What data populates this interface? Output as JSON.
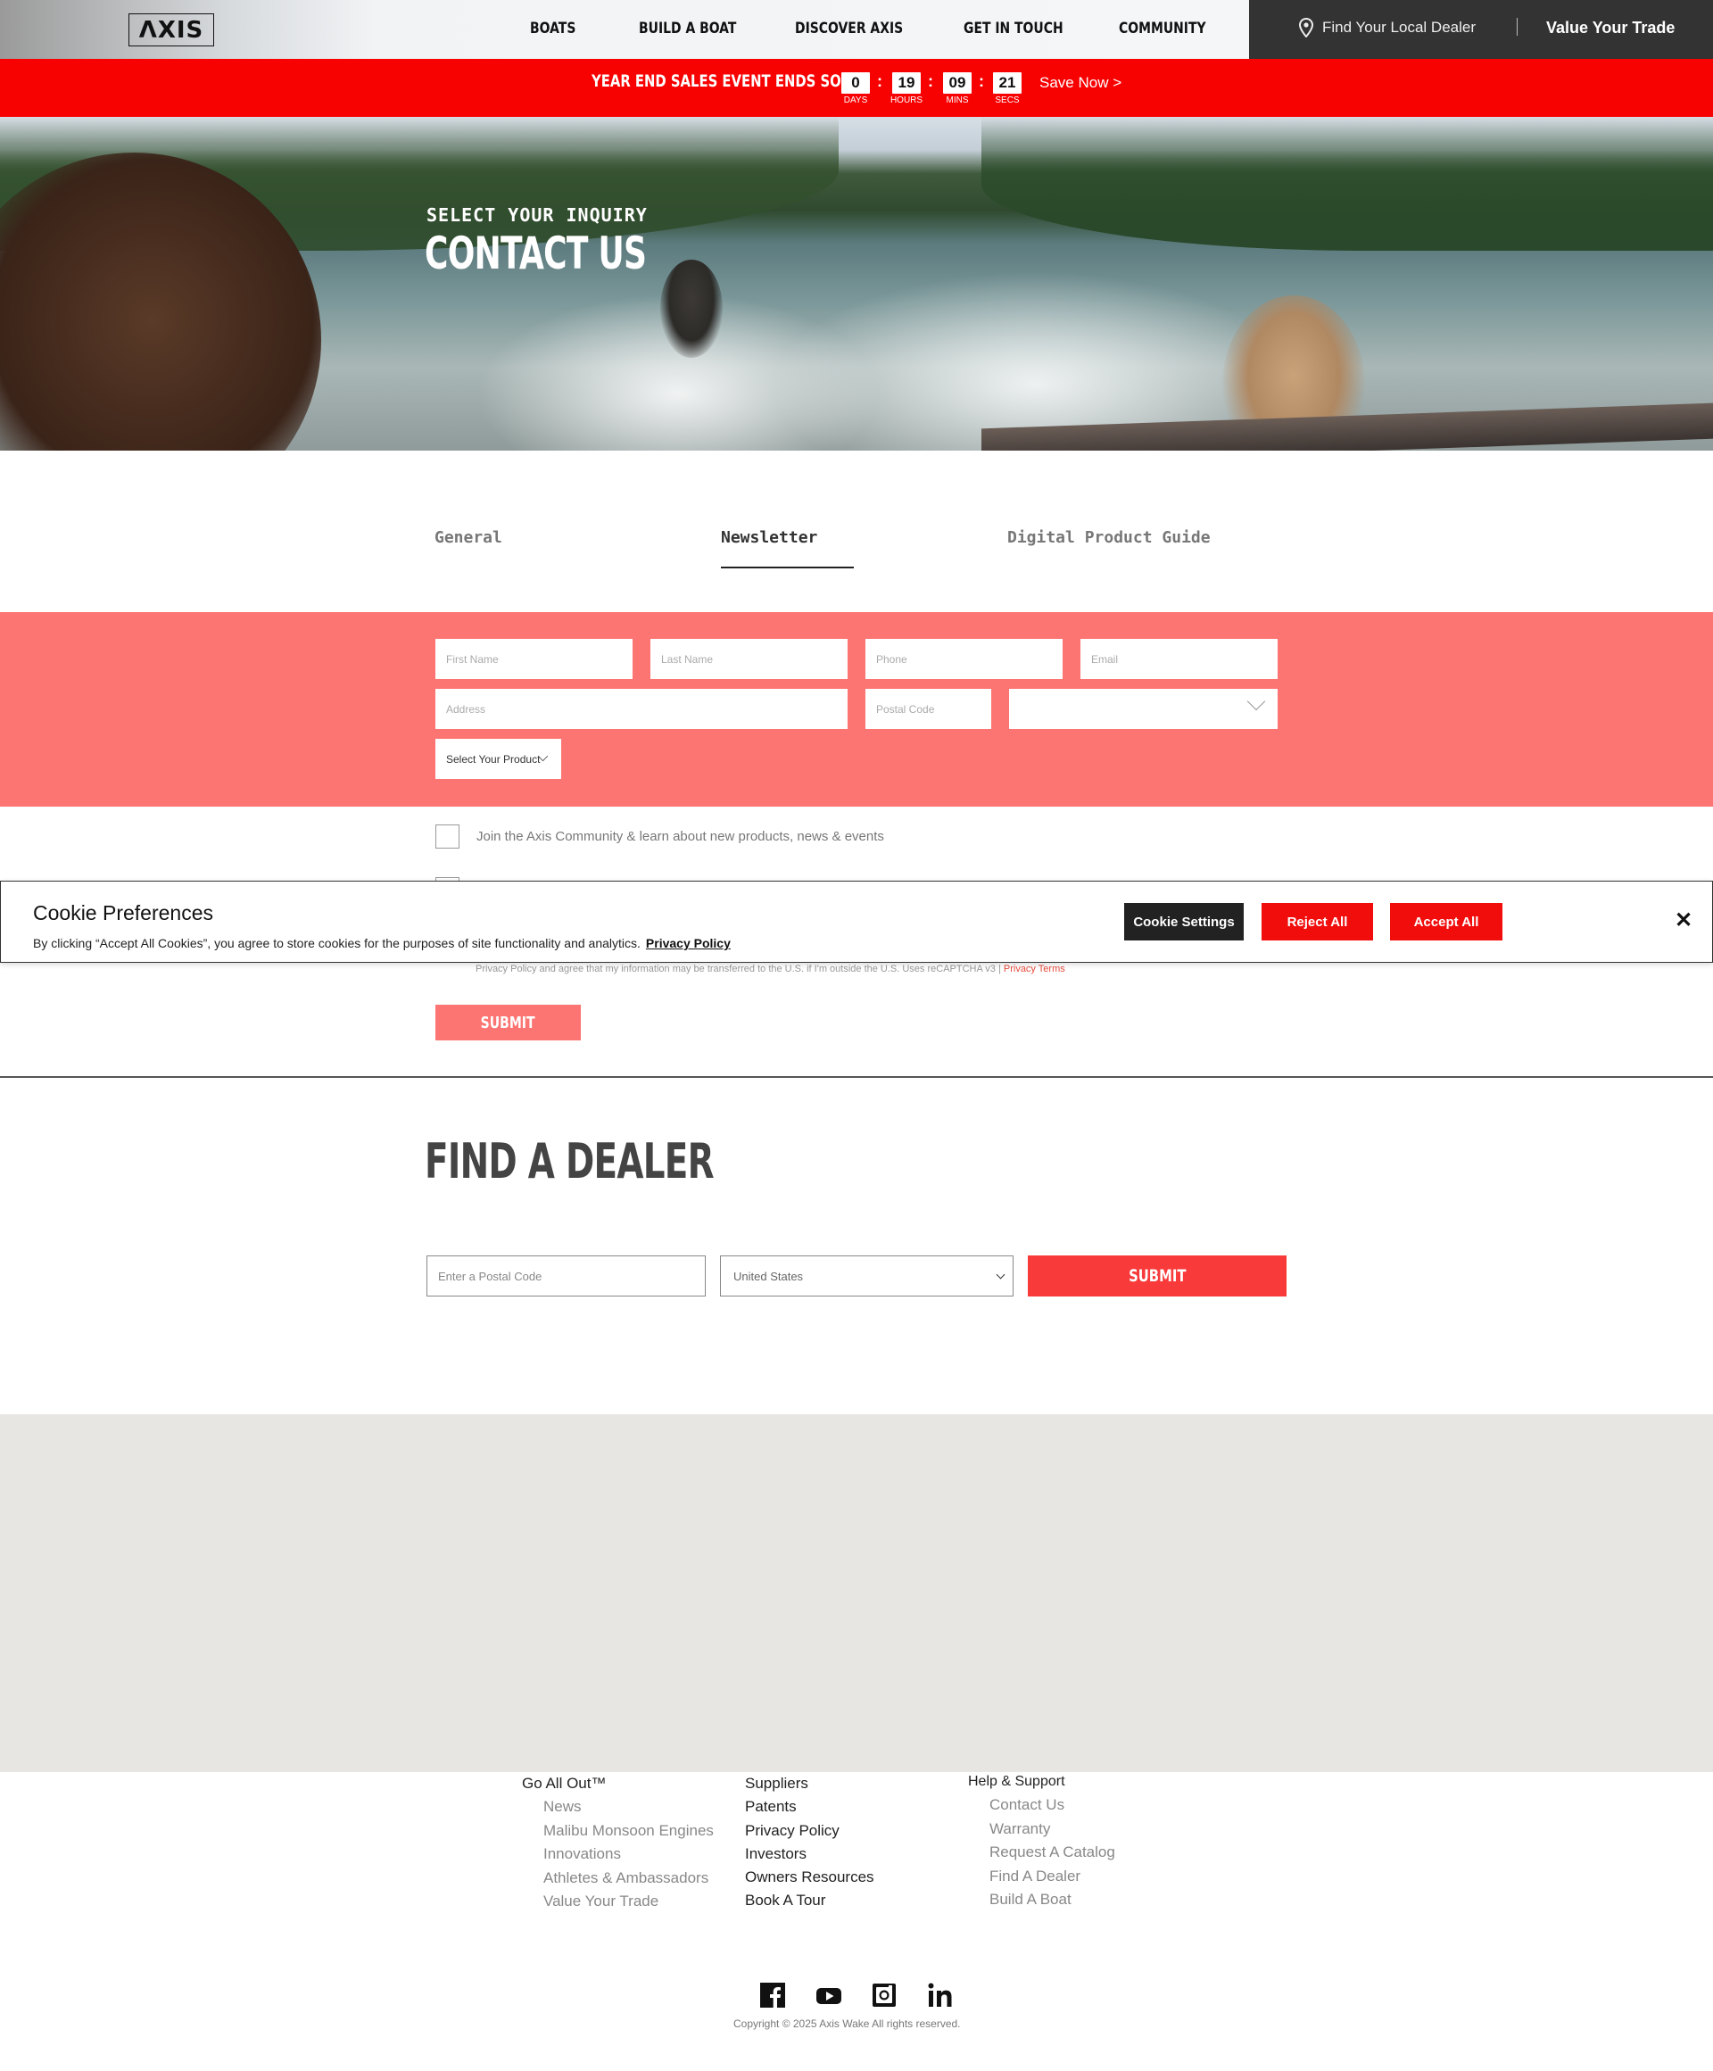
{
  "header": {
    "logo_text": "ΛXIS",
    "nav": [
      "BOATS",
      "BUILD A BOAT",
      "DISCOVER AXIS",
      "GET IN TOUCH",
      "COMMUNITY"
    ],
    "dealer_link": "Find Your Local Dealer",
    "trade_link": "Value Your Trade"
  },
  "promo": {
    "text": "YEAR END SALES EVENT ENDS SOON",
    "countdown": [
      {
        "value": "0",
        "label": "DAYS"
      },
      {
        "value": "19",
        "label": "HOURS"
      },
      {
        "value": "09",
        "label": "MINS"
      },
      {
        "value": "21",
        "label": "SECS"
      }
    ],
    "cta": "Save Now >"
  },
  "hero": {
    "subtitle": "SELECT YOUR INQUIRY",
    "title": "CONTACT US"
  },
  "tabs": [
    {
      "label": "General",
      "active": false
    },
    {
      "label": "Newsletter",
      "active": true
    },
    {
      "label": "Digital Product Guide",
      "active": false
    }
  ],
  "form": {
    "first_name": "First Name",
    "last_name": "Last Name",
    "phone": "Phone",
    "email": "Email",
    "address": "Address",
    "postal_code": "Postal Code",
    "country": "",
    "product": "Select Your Product"
  },
  "consent": {
    "community_label": "Join the Axis Community & learn about new products, news & events",
    "privacy_text": "Privacy Policy and agree that my information may be transferred to the U.S. if I'm outside the U.S. Uses reCAPTCHA v3 |",
    "privacy_terms": "Privacy Terms",
    "submit": "SUBMIT"
  },
  "cookie": {
    "title": "Cookie Preferences",
    "text": "By clicking “Accept All Cookies”, you agree to store cookies for the purposes of site functionality and analytics.",
    "policy_link": "Privacy Policy",
    "settings": "Cookie Settings",
    "reject": "Reject All",
    "accept": "Accept All",
    "close": "✕"
  },
  "find_dealer": {
    "title": "FIND A DEALER",
    "postal_placeholder": "Enter a Postal Code",
    "country": "United States",
    "submit": "SUBMIT"
  },
  "footer": {
    "col1": {
      "heading": "Go All Out™",
      "links": [
        "News",
        "Malibu Monsoon Engines",
        "Innovations",
        "Athletes & Ambassadors",
        "Value Your Trade"
      ]
    },
    "col2": {
      "links": [
        "Suppliers",
        "Patents",
        "Privacy Policy",
        "Investors",
        "Owners Resources",
        "Book A Tour"
      ]
    },
    "col3": {
      "heading": "Help & Support",
      "links": [
        "Contact Us",
        "Warranty",
        "Request A Catalog",
        "Find A Dealer",
        "Build A Boat"
      ]
    },
    "social_icons": [
      "facebook-icon",
      "youtube-icon",
      "instagram-icon",
      "linkedin-icon"
    ],
    "copyright": "Copyright © 2025 Axis Wake All rights reserved."
  },
  "colors": {
    "promo_red": "#f80101",
    "form_band": "#fd7572",
    "button_red": "#f20d0d",
    "dark": "#333333"
  }
}
